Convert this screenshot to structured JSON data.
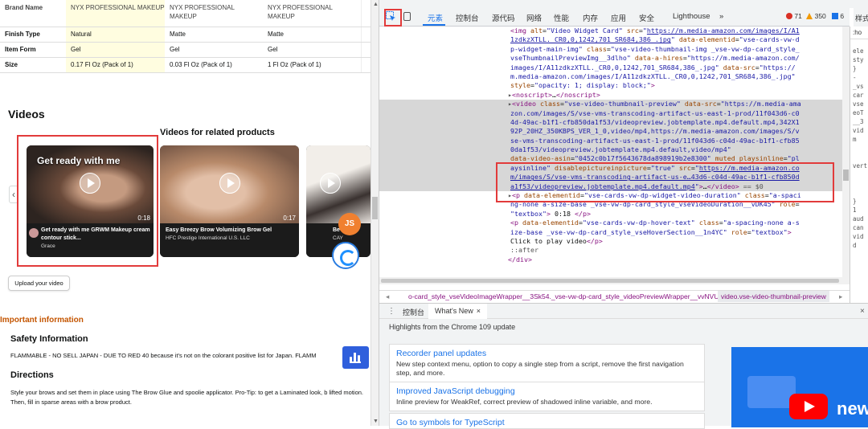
{
  "page": {
    "url_fragment": "amazon.com/dp/B0CM803WB7/pd_rd_i=B0CM803WB7&pd_rd_p=4aa0d1a6-e4c0-4e25-b8ee-2b6f02a6836d&pd_rd_r=SYMAK2GTW7KX1MHW",
    "spec_table": {
      "brands": [
        "NYX PROFESSIONAL MAKEUP",
        "NYX PROFESSIONAL MAKEUP",
        "NYX PROFESSIONAL MAKEUP"
      ],
      "rows": [
        {
          "label": "Brand Name",
          "values": [
            "NYX PROFESSIONAL MAKEUP",
            "NYX PROFESSIONAL MAKEUP",
            "NYX PROFESSIONAL MAKEUP"
          ]
        },
        {
          "label": "Finish Type",
          "values": [
            "Natural",
            "Matte",
            "Matte"
          ]
        },
        {
          "label": "Item Form",
          "values": [
            "Gel",
            "Gel",
            "Gel"
          ]
        },
        {
          "label": "Size",
          "values": [
            "0.17 Fl Oz (Pack of 1)",
            "0.03 Fl Oz (Pack of 1)",
            "1 Fl Oz (Pack of 1)"
          ]
        }
      ]
    },
    "videos_title": "Videos",
    "related_title": "Videos for related products",
    "cards": [
      {
        "overlay": "Get ready with me",
        "duration": "0:18",
        "title": "Get ready with me GRWM Makeup cream contour stick...",
        "author": "Grace"
      },
      {
        "overlay": "",
        "duration": "0:17",
        "title": "Easy Breezy Brow Volumizing Brow Gel",
        "author": "HFC Prestige International U.S. LLC"
      },
      {
        "overlay": "",
        "duration": "",
        "title": "Be",
        "author": "CAY"
      }
    ],
    "upload_label": "Upload your video",
    "important_info": "Important information",
    "safety_heading": "Safety Information",
    "safety_text": "FLAMMABLE - NO SELL JAPAN - DUE TO RED 40 because it's not on the colorant positive list for Japan. FLAMM",
    "directions_heading": "Directions",
    "directions_text": "Style your brows and set them in place using The Brow Glue and spoolie applicator. Pro-Tip: to get a Laminated look, b lifted motion. Then, fill in sparse areas with a brow product.",
    "float_js_label": "JS"
  },
  "devtools": {
    "tabs": [
      "元素",
      "控制台",
      "源代码",
      "网络",
      "性能",
      "内存",
      "应用",
      "安全",
      "Lighthouse",
      "»"
    ],
    "errors": "71",
    "warnings": "350",
    "issues": "6",
    "styles_tab": "样式",
    "styles_filter": ":ho",
    "code_lines": [
      {
        "html": "<span class='tag'>&lt;img</span> <span class='attr'>alt</span>=<span class='val'>\"Video Widget Card\"</span> <span class='attr'>src</span>=<span class='val'>\"</span><span class='link'>https://m.media-amazon.com/images/I/A1</span>"
      },
      {
        "html": "<span class='link'>1zdkzXTLL._CR0,0,1242,701_SR684,386_.jpg</span><span class='val'>\"</span> <span class='attr'>data-elementid</span>=<span class='val'>\"vse-cards-vw-d</span>"
      },
      {
        "html": "<span class='val'>p-widget-main-img\"</span> <span class='attr'>class</span>=<span class='val'>\"vse-video-thumbnail-img _vse-vw-dp-card_style_</span>"
      },
      {
        "html": "<span class='val'>vseThumbnailPreviewImg__3dlho\"</span> <span class='attr'>data-a-hires</span>=<span class='val'>\"https://m.media-amazon.com/</span>"
      },
      {
        "html": "<span class='val'>images/I/A11zdkzXTLL._CR0,0,1242,701_SR684,386_.jpg\"</span> <span class='attr'>data-src</span>=<span class='val'>\"https://</span>"
      },
      {
        "html": "<span class='val'>m.media-amazon.com/images/I/A11zdkzXTLL._CR0,0,1242,701_SR684,386_.jpg\"</span>"
      },
      {
        "html": "<span class='attr'>style</span>=<span class='val'>\"opacity: 1; display: block;\"</span><span class='tag'>&gt;</span>"
      },
      {
        "html": "<span class='tri'>▸</span><span class='tag'>&lt;noscript&gt;</span>…<span class='tag'>&lt;/noscript&gt;</span>",
        "cls": "cont"
      },
      {
        "html": "<span class='tri'>▸</span><span class='tag'>&lt;video</span> <span class='attr'>class</span>=<span class='val'>\"vse-video-thumbnail-preview\"</span> <span class='attr'>data-src</span>=<span class='val'>\"https://m.media-ama</span>",
        "cls": "cont hl"
      },
      {
        "html": "<span class='val'>zon.com/images/S/vse-vms-transcoding-artifact-us-east-1-prod/11f043d6-c0</span>",
        "cls": "hl"
      },
      {
        "html": "<span class='val'>4d-49ac-b1f1-cfb850da1f53/videopreview.jobtemplate.mp4.default.mp4,342X1</span>",
        "cls": "hl"
      },
      {
        "html": "<span class='val'>92P_20HZ_350KBPS_VER_1_0,video/mp4,https://m.media-amazon.com/images/S/v</span>",
        "cls": "hl"
      },
      {
        "html": "<span class='val'>se-vms-transcoding-artifact-us-east-1-prod/11f043d6-c04d-49ac-b1f1-cfb85</span>",
        "cls": "hl"
      },
      {
        "html": "<span class='val'>0da1f53/videopreview.jobtemplate.mp4.default,video/mp4\"</span>",
        "cls": "hl"
      },
      {
        "html": "<span class='attr'>data-video-asin</span>=<span class='val'>\"0452c0b17f5643678da898919b2e8300\"</span> <span class='attr'>muted playsinline</span>=<span class='val'>\"pl</span>",
        "cls": "hl"
      },
      {
        "html": "<span class='val'>aysinline\"</span> <span class='attr'>disablepictureinpicture</span>=<span class='val'>\"true\"</span> <span class='attr'>src</span>=<span class='val'>\"</span><span class='link'>https://m.media-amazon.co</span>",
        "cls": "hl"
      },
      {
        "html": "<span class='link'>m/images/S/vse-vms-transcoding-artifact-us-e…43d6-c04d-49ac-b1f1-cfb850d</span>",
        "cls": "hl"
      },
      {
        "html": "<span class='link'>a1f53/videopreview.jobtemplate.mp4.default.mp4</span><span class='val'>\"</span><span class='tag'>&gt;</span>…<span class='tag'>&lt;/video&gt;</span> <span class='gray'>== $0</span>",
        "cls": "hl"
      },
      {
        "html": "<span class='tri'>▸</span><span class='tag'>&lt;p</span> <span class='attr'>data-elementid</span>=<span class='val'>\"vse-cards-vw-dp-widget-video-duration\"</span> <span class='attr'>class</span>=<span class='val'>\"a-spaci</span>",
        "cls": "cont"
      },
      {
        "html": "<span class='val'>ng-none a-size-base _vse-vw-dp-card_style_vseVideoDuration__vDK45\"</span> <span class='attr'>role</span>="
      },
      {
        "html": "<span class='val'>\"textbox\"</span><span class='tag'>&gt;</span> 0:18 <span class='tag'>&lt;/p&gt;</span>"
      },
      {
        "html": "<span class='tag'>&lt;p</span> <span class='attr'>data-elementid</span>=<span class='val'>\"vse-cards-vw-dp-hover-text\"</span> <span class='attr'>class</span>=<span class='val'>\"a-spacing-none a-s</span>"
      },
      {
        "html": "<span class='val'>ize-base _vse-vw-dp-card_style_vseHoverSection__1n4YC\"</span> <span class='attr'>role</span>=<span class='val'>\"textbox\"</span><span class='tag'>&gt;</span>"
      },
      {
        "html": "Click to play video<span class='tag'>&lt;/p&gt;</span>"
      },
      {
        "html": "<span class='gray'>::after</span>"
      },
      {
        "html": "<span class='tag'>&lt;/div&gt;</span>",
        "cls": "cont"
      }
    ],
    "breadcrumb_left": "o-card_style_vseVideoImageWrapper__3Sk54._vse-vw-dp-card_style_videoPreviewWrapper__vvNVU",
    "breadcrumb_right": "video.vse-video-thumbnail-preview",
    "drawer_tab_console": "控制台",
    "drawer_tab_whatsnew": "What's New",
    "whatsnew_header": "Highlights from the Chrome 109 update",
    "whatsnew_items": [
      {
        "title": "Recorder panel updates",
        "desc": "New step context menu, option to copy a single step from a script, remove the first navigation step, and more."
      },
      {
        "title": "Improved JavaScript debugging",
        "desc": "Inline preview for WeakRef, correct preview of shadowed inline variable, and more."
      },
      {
        "title": "Go to symbols for TypeScript",
        "desc": ""
      }
    ],
    "video_new_label": "new",
    "styles_lines": [
      "ele",
      "sty",
      "}",
      "-",
      "_vs",
      "car",
      "vse",
      "eoT",
      "__3",
      "vid",
      "m",
      "",
      "",
      "vert",
      "",
      "",
      "",
      "}",
      "1",
      "aud",
      "can",
      "vid",
      "d"
    ]
  },
  "colors": {
    "highlight_box": "#e23b3b",
    "accent": "#1a73e8",
    "important": "#c45500"
  }
}
